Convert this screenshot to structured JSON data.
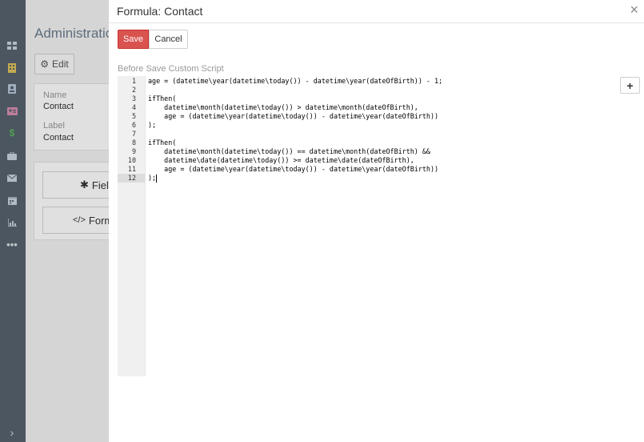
{
  "background": {
    "title": "Administration",
    "edit_label": "Edit",
    "name_label": "Name",
    "name_value": "Contact",
    "label_label": "Label",
    "label_value": "Contact",
    "fields_btn": "Fields",
    "formula_btn": "Formula"
  },
  "modal": {
    "title": "Formula: Contact",
    "save_label": "Save",
    "cancel_label": "Cancel",
    "field_label": "Before Save Custom Script",
    "add_label": "+",
    "close_glyph": "×"
  },
  "code_lines": [
    "age = (datetime\\year(datetime\\today()) - datetime\\year(dateOfBirth)) - 1;",
    "",
    "ifThen(",
    "    datetime\\month(datetime\\today()) > datetime\\month(dateOfBirth),",
    "    age = (datetime\\year(datetime\\today()) - datetime\\year(dateOfBirth))",
    ");",
    "",
    "ifThen(",
    "    datetime\\month(datetime\\today()) == datetime\\month(dateOfBirth) &&",
    "    datetime\\date(datetime\\today()) >= datetime\\date(dateOfBirth),",
    "    age = (datetime\\year(datetime\\today()) - datetime\\year(dateOfBirth))",
    ");"
  ],
  "line_numbers": [
    "1",
    "2",
    "3",
    "4",
    "5",
    "6",
    "7",
    "8",
    "9",
    "10",
    "11",
    "12"
  ],
  "active_line": 12,
  "sidebar_icons": [
    "menu-icon",
    "dashboard-icon",
    "accounts-icon",
    "contacts-icon",
    "leads-icon",
    "opportunities-icon",
    "cases-icon",
    "email-icon",
    "calendar-icon",
    "reports-icon",
    "more-icon",
    "expand-icon"
  ],
  "colors": {
    "sidebar": "#56626e",
    "save": "#d9534f",
    "title": "#6a7c8e"
  }
}
